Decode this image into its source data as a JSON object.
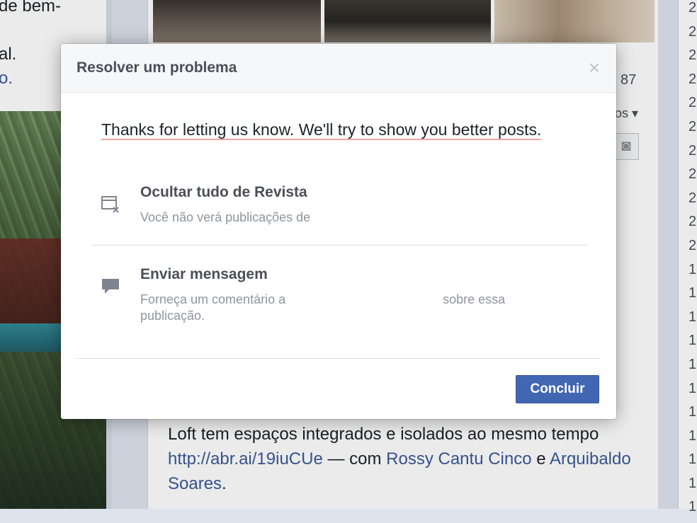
{
  "background": {
    "left_text": [
      "de bem-",
      "al.",
      "o."
    ],
    "like_count": "87",
    "todos_label": "os ▾",
    "caption": {
      "text1": "Loft tem espaços integrados e isolados ao mesmo tempo ",
      "link": "http://abr.ai/19iuCUe",
      "text2": " — com ",
      "person1": "Rossy Cantu Cinco",
      "text3": " e ",
      "person2": "Arquibaldo Soares",
      "text4": "."
    },
    "right_column": [
      "2",
      "2",
      "2",
      "2",
      "2",
      "2",
      "2",
      "2",
      "2",
      "2",
      "2",
      "1",
      "1",
      "1",
      "1",
      "1",
      "1",
      "1",
      "1",
      "1",
      "1",
      "1"
    ]
  },
  "dialog": {
    "title": "Resolver um problema",
    "close_glyph": "×",
    "thanks_text": "Thanks for letting us know. We'll try to show you better posts.",
    "options": [
      {
        "icon": "hide-window-icon",
        "title": "Ocultar tudo de Revista",
        "description": "Você não verá publicações de"
      },
      {
        "icon": "speech-bubble-icon",
        "title": "Enviar mensagem",
        "description_before": "Forneça um comentário a",
        "description_after": "sobre essa publicação."
      }
    ],
    "done_label": "Concluir",
    "accent_color": "#4267b2"
  }
}
